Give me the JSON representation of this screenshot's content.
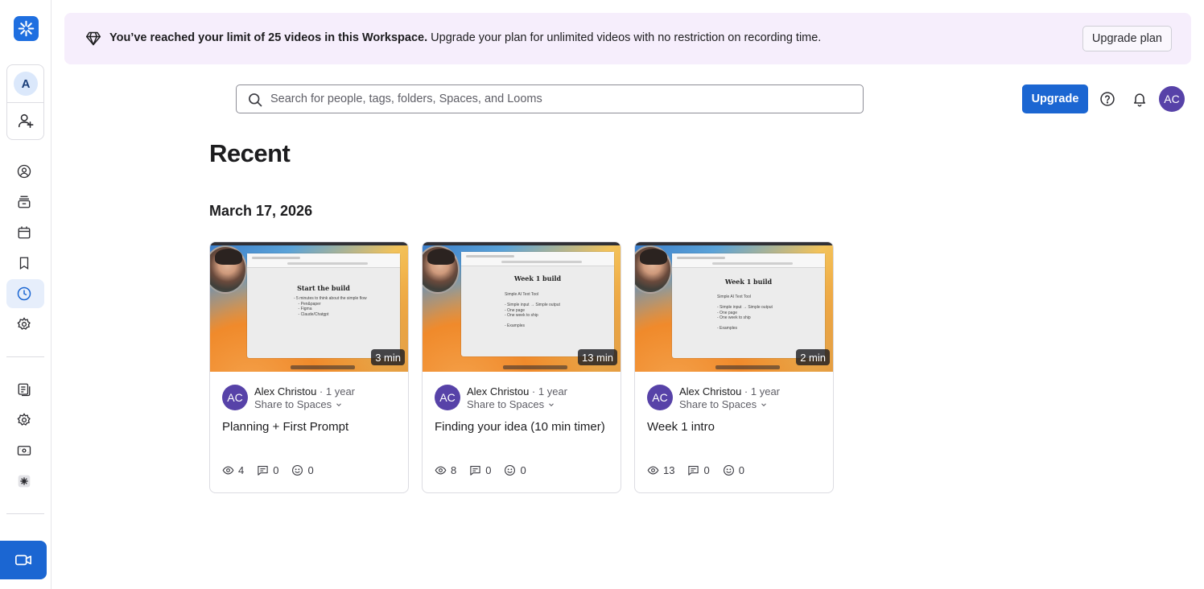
{
  "sidebar": {
    "workspace_initial": "A"
  },
  "banner": {
    "bold_text": "You’ve reached your limit of 25 videos in this Workspace.",
    "text": " Upgrade your plan for unlimited videos with no restriction on recording time.",
    "button_label": "Upgrade plan"
  },
  "header": {
    "search_placeholder": "Search for people, tags, folders, Spaces, and Looms",
    "upgrade_label": "Upgrade",
    "user_initials": "AC"
  },
  "main": {
    "title": "Recent",
    "date_heading": "March 17, 2026",
    "videos": [
      {
        "duration": "3 min",
        "author": "Alex Christou",
        "age": "1 year",
        "share_label": "Share to Spaces",
        "title": "Planning + First Prompt",
        "views": "4",
        "comments": "0",
        "reactions": "0",
        "initials": "AC",
        "thumb_heading": "Start the build",
        "thumb_lines": "- 5 minutes to think about the simple flow\n    - Pen&paper\n    - Figma\n    - Claude/Chatgpt"
      },
      {
        "duration": "13 min",
        "author": "Alex Christou",
        "age": "1 year",
        "share_label": "Share to Spaces",
        "title": "Finding your idea (10 min timer)",
        "views": "8",
        "comments": "0",
        "reactions": "0",
        "initials": "AC",
        "thumb_heading": "Week 1 build",
        "thumb_lines": "Simple AI Text Tool\n\n- Simple input → Simple output\n- One page\n- One week to ship\n\n- Examples"
      },
      {
        "duration": "2 min",
        "author": "Alex Christou",
        "age": "1 year",
        "share_label": "Share to Spaces",
        "title": "Week 1 intro",
        "views": "13",
        "comments": "0",
        "reactions": "0",
        "initials": "AC",
        "thumb_heading": "Week 1 build",
        "thumb_lines": "Simple AI Text Tool\n\n- Simple input → Simple output\n- One page\n- One week to ship\n\n- Examples"
      }
    ]
  },
  "icons": {
    "logo": "loom-logo-icon",
    "invite": "add-user-icon",
    "nav": [
      "my-videos-icon",
      "library-icon",
      "calendar-icon",
      "bookmark-icon",
      "clock-icon",
      "settings-icon",
      "notes-icon",
      "gear-icon",
      "billing-icon",
      "apps-icon"
    ],
    "record": "camera-icon"
  },
  "colors": {
    "primary": "#1b66d2",
    "banner_bg": "#f6eefc",
    "avatar": "#5742a8",
    "active_nav_bg": "#e6eefb"
  }
}
